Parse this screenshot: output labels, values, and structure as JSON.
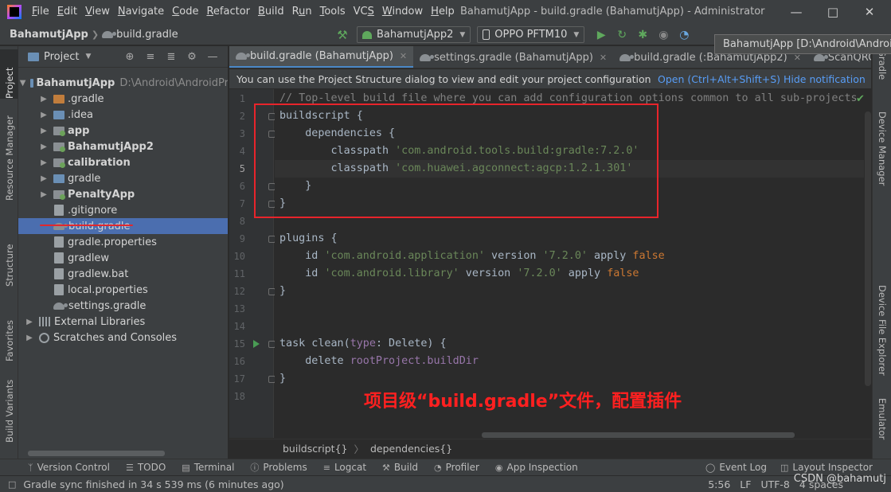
{
  "menubar": {
    "items": [
      "File",
      "Edit",
      "View",
      "Navigate",
      "Code",
      "Refactor",
      "Build",
      "Run",
      "Tools",
      "VCS",
      "Window",
      "Help"
    ],
    "mnemonics": [
      "F",
      "E",
      "V",
      "N",
      "C",
      "R",
      "B",
      "u",
      "T",
      "S",
      "W",
      "H"
    ],
    "title": "BahamutjApp - build.gradle (BahamutjApp) - Administrator"
  },
  "navbar": {
    "project": "BahamutjApp",
    "file": "build.gradle",
    "run_config": "BahamutjApp2",
    "device": "OPPO PFTM10"
  },
  "tooltip": "BahamutjApp [D:\\Android\\AndroidProj",
  "left_strip": [
    "Project",
    "Resource Manager",
    "Structure",
    "Favorites",
    "Build Variants"
  ],
  "project_panel": {
    "title": "Project",
    "tree": [
      {
        "label": "BahamutjApp",
        "path": "D:\\Android\\AndroidPr",
        "depth": 0,
        "expanded": true,
        "bold": true
      },
      {
        "label": ".gradle",
        "depth": 1,
        "icon": "orange-folder"
      },
      {
        "label": ".idea",
        "depth": 1,
        "icon": "folder"
      },
      {
        "label": "app",
        "depth": 1,
        "icon": "module-folder",
        "bold": true
      },
      {
        "label": "BahamutjApp2",
        "depth": 1,
        "icon": "module-folder",
        "bold": true
      },
      {
        "label": "calibration",
        "depth": 1,
        "icon": "module-folder",
        "bold": true
      },
      {
        "label": "gradle",
        "depth": 1,
        "icon": "folder"
      },
      {
        "label": "PenaltyApp",
        "depth": 1,
        "icon": "module-folder",
        "bold": true
      },
      {
        "label": ".gitignore",
        "depth": 1,
        "icon": "file"
      },
      {
        "label": "build.gradle",
        "depth": 1,
        "icon": "gradle",
        "selected": true
      },
      {
        "label": "gradle.properties",
        "depth": 1,
        "icon": "file"
      },
      {
        "label": "gradlew",
        "depth": 1,
        "icon": "file"
      },
      {
        "label": "gradlew.bat",
        "depth": 1,
        "icon": "file"
      },
      {
        "label": "local.properties",
        "depth": 1,
        "icon": "file"
      },
      {
        "label": "settings.gradle",
        "depth": 1,
        "icon": "gradle"
      },
      {
        "label": "External Libraries",
        "depth": 0,
        "icon": "library"
      },
      {
        "label": "Scratches and Consoles",
        "depth": 0,
        "icon": "scratch"
      }
    ]
  },
  "editor_tabs": [
    {
      "label": "build.gradle (BahamutjApp)",
      "active": true
    },
    {
      "label": "settings.gradle (BahamutjApp)",
      "active": false
    },
    {
      "label": "build.gradle (:BahamutjApp2)",
      "active": false
    },
    {
      "label": "ScanQRCodeActi",
      "active": false
    }
  ],
  "notification": {
    "message": "You can use the Project Structure dialog to view and edit your project configuration",
    "open_link": "Open (Ctrl+Alt+Shift+S)",
    "hide_link": "Hide notification"
  },
  "code_lines": [
    {
      "n": "1",
      "text": "// Top-level build file where you can add configuration options common to all sub-projects"
    },
    {
      "n": "2",
      "text": "buildscript {"
    },
    {
      "n": "3",
      "text": "    dependencies {"
    },
    {
      "n": "4",
      "text": "        classpath 'com.android.tools.build:gradle:7.2.0'"
    },
    {
      "n": "5",
      "text": "        classpath 'com.huawei.agconnect:agcp:1.2.1.301'"
    },
    {
      "n": "6",
      "text": "    }"
    },
    {
      "n": "7",
      "text": "}"
    },
    {
      "n": "8",
      "text": ""
    },
    {
      "n": "9",
      "text": "plugins {"
    },
    {
      "n": "10",
      "text": "    id 'com.android.application' version '7.2.0' apply false"
    },
    {
      "n": "11",
      "text": "    id 'com.android.library' version '7.2.0' apply false"
    },
    {
      "n": "12",
      "text": "}"
    },
    {
      "n": "13",
      "text": ""
    },
    {
      "n": "14",
      "text": ""
    },
    {
      "n": "15",
      "text": "task clean(type: Delete) {"
    },
    {
      "n": "16",
      "text": "    delete rootProject.buildDir"
    },
    {
      "n": "17",
      "text": "}"
    },
    {
      "n": "18",
      "text": ""
    }
  ],
  "current_line": 5,
  "annotation": "项目级“build.gradle”文件，配置插件",
  "editor_breadcrumb": [
    "buildscript{}",
    "dependencies{}"
  ],
  "right_strip": [
    "Gradle",
    "Device Manager",
    "Device File Explorer",
    "Emulator"
  ],
  "bottom_tools": [
    "Version Control",
    "TODO",
    "Terminal",
    "Problems",
    "Logcat",
    "Build",
    "Profiler",
    "App Inspection",
    "Event Log",
    "Layout Inspector"
  ],
  "status": {
    "message": "Gradle sync finished in 34 s 539 ms (6 minutes ago)",
    "position": "5:56",
    "line_sep": "LF",
    "encoding": "UTF-8",
    "indent": "4 spaces"
  },
  "watermark": "CSDN @bahamutj",
  "colors": {
    "accent": "#4a88c7",
    "selection": "#4b6eaf",
    "annotation_red": "#ff2020",
    "string_green": "#6a8759",
    "keyword_orange": "#cc7832"
  }
}
